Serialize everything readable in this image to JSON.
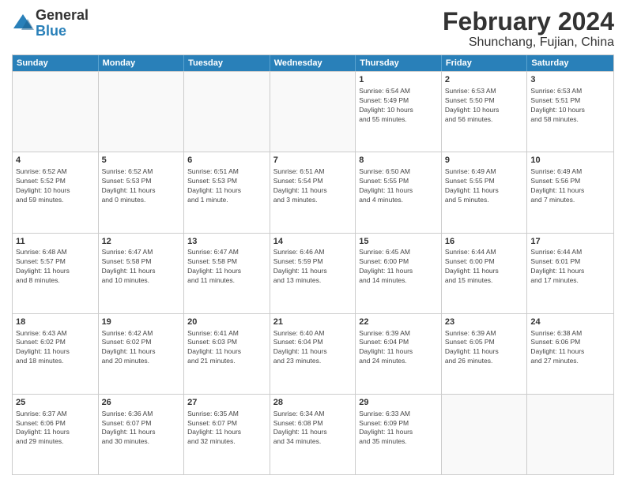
{
  "logo": {
    "general": "General",
    "blue": "Blue"
  },
  "title": "February 2024",
  "subtitle": "Shunchang, Fujian, China",
  "header_days": [
    "Sunday",
    "Monday",
    "Tuesday",
    "Wednesday",
    "Thursday",
    "Friday",
    "Saturday"
  ],
  "weeks": [
    [
      {
        "day": "",
        "info": ""
      },
      {
        "day": "",
        "info": ""
      },
      {
        "day": "",
        "info": ""
      },
      {
        "day": "",
        "info": ""
      },
      {
        "day": "1",
        "info": "Sunrise: 6:54 AM\nSunset: 5:49 PM\nDaylight: 10 hours\nand 55 minutes."
      },
      {
        "day": "2",
        "info": "Sunrise: 6:53 AM\nSunset: 5:50 PM\nDaylight: 10 hours\nand 56 minutes."
      },
      {
        "day": "3",
        "info": "Sunrise: 6:53 AM\nSunset: 5:51 PM\nDaylight: 10 hours\nand 58 minutes."
      }
    ],
    [
      {
        "day": "4",
        "info": "Sunrise: 6:52 AM\nSunset: 5:52 PM\nDaylight: 10 hours\nand 59 minutes."
      },
      {
        "day": "5",
        "info": "Sunrise: 6:52 AM\nSunset: 5:53 PM\nDaylight: 11 hours\nand 0 minutes."
      },
      {
        "day": "6",
        "info": "Sunrise: 6:51 AM\nSunset: 5:53 PM\nDaylight: 11 hours\nand 1 minute."
      },
      {
        "day": "7",
        "info": "Sunrise: 6:51 AM\nSunset: 5:54 PM\nDaylight: 11 hours\nand 3 minutes."
      },
      {
        "day": "8",
        "info": "Sunrise: 6:50 AM\nSunset: 5:55 PM\nDaylight: 11 hours\nand 4 minutes."
      },
      {
        "day": "9",
        "info": "Sunrise: 6:49 AM\nSunset: 5:55 PM\nDaylight: 11 hours\nand 5 minutes."
      },
      {
        "day": "10",
        "info": "Sunrise: 6:49 AM\nSunset: 5:56 PM\nDaylight: 11 hours\nand 7 minutes."
      }
    ],
    [
      {
        "day": "11",
        "info": "Sunrise: 6:48 AM\nSunset: 5:57 PM\nDaylight: 11 hours\nand 8 minutes."
      },
      {
        "day": "12",
        "info": "Sunrise: 6:47 AM\nSunset: 5:58 PM\nDaylight: 11 hours\nand 10 minutes."
      },
      {
        "day": "13",
        "info": "Sunrise: 6:47 AM\nSunset: 5:58 PM\nDaylight: 11 hours\nand 11 minutes."
      },
      {
        "day": "14",
        "info": "Sunrise: 6:46 AM\nSunset: 5:59 PM\nDaylight: 11 hours\nand 13 minutes."
      },
      {
        "day": "15",
        "info": "Sunrise: 6:45 AM\nSunset: 6:00 PM\nDaylight: 11 hours\nand 14 minutes."
      },
      {
        "day": "16",
        "info": "Sunrise: 6:44 AM\nSunset: 6:00 PM\nDaylight: 11 hours\nand 15 minutes."
      },
      {
        "day": "17",
        "info": "Sunrise: 6:44 AM\nSunset: 6:01 PM\nDaylight: 11 hours\nand 17 minutes."
      }
    ],
    [
      {
        "day": "18",
        "info": "Sunrise: 6:43 AM\nSunset: 6:02 PM\nDaylight: 11 hours\nand 18 minutes."
      },
      {
        "day": "19",
        "info": "Sunrise: 6:42 AM\nSunset: 6:02 PM\nDaylight: 11 hours\nand 20 minutes."
      },
      {
        "day": "20",
        "info": "Sunrise: 6:41 AM\nSunset: 6:03 PM\nDaylight: 11 hours\nand 21 minutes."
      },
      {
        "day": "21",
        "info": "Sunrise: 6:40 AM\nSunset: 6:04 PM\nDaylight: 11 hours\nand 23 minutes."
      },
      {
        "day": "22",
        "info": "Sunrise: 6:39 AM\nSunset: 6:04 PM\nDaylight: 11 hours\nand 24 minutes."
      },
      {
        "day": "23",
        "info": "Sunrise: 6:39 AM\nSunset: 6:05 PM\nDaylight: 11 hours\nand 26 minutes."
      },
      {
        "day": "24",
        "info": "Sunrise: 6:38 AM\nSunset: 6:06 PM\nDaylight: 11 hours\nand 27 minutes."
      }
    ],
    [
      {
        "day": "25",
        "info": "Sunrise: 6:37 AM\nSunset: 6:06 PM\nDaylight: 11 hours\nand 29 minutes."
      },
      {
        "day": "26",
        "info": "Sunrise: 6:36 AM\nSunset: 6:07 PM\nDaylight: 11 hours\nand 30 minutes."
      },
      {
        "day": "27",
        "info": "Sunrise: 6:35 AM\nSunset: 6:07 PM\nDaylight: 11 hours\nand 32 minutes."
      },
      {
        "day": "28",
        "info": "Sunrise: 6:34 AM\nSunset: 6:08 PM\nDaylight: 11 hours\nand 34 minutes."
      },
      {
        "day": "29",
        "info": "Sunrise: 6:33 AM\nSunset: 6:09 PM\nDaylight: 11 hours\nand 35 minutes."
      },
      {
        "day": "",
        "info": ""
      },
      {
        "day": "",
        "info": ""
      }
    ]
  ]
}
